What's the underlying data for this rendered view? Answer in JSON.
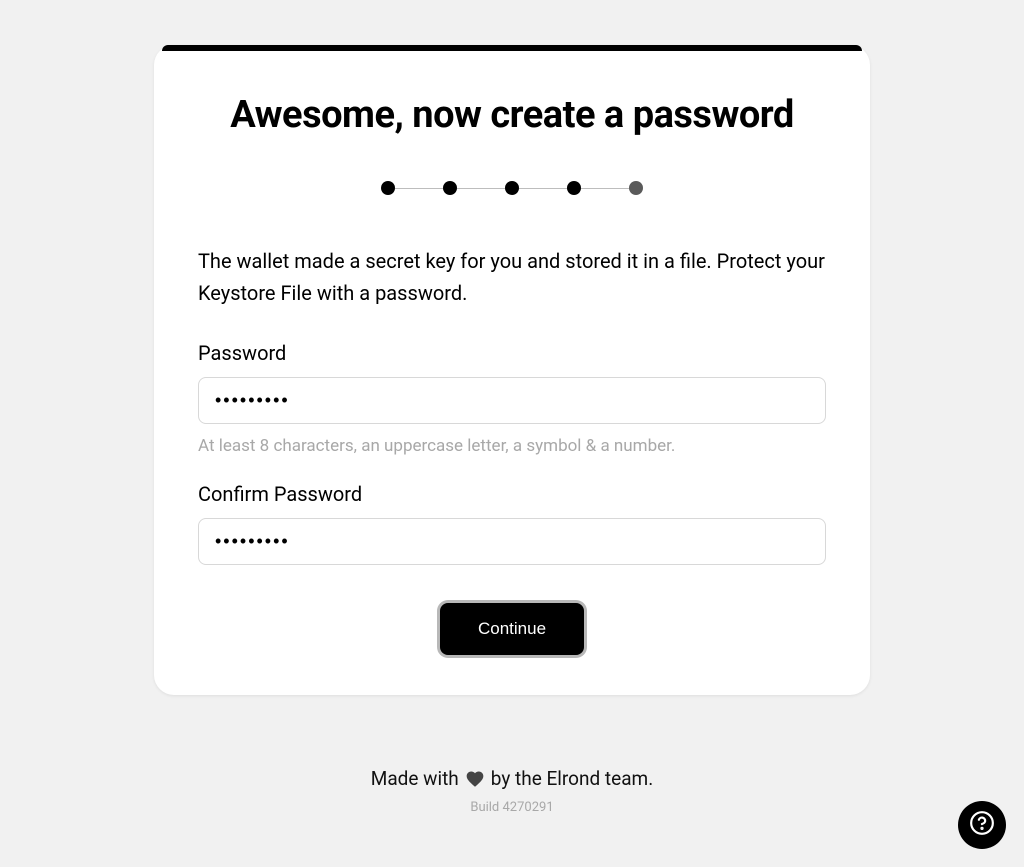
{
  "title": "Awesome, now create a password",
  "stepper": {
    "total": 5,
    "current": 4
  },
  "description": "The wallet made a secret key for you and stored it in a file. Protect your Keystore File with a password.",
  "password": {
    "label": "Password",
    "value": "•••••••••",
    "hint": "At least 8 characters, an uppercase letter, a symbol & a number."
  },
  "confirm_password": {
    "label": "Confirm Password",
    "value": "•••••••••"
  },
  "continue_label": "Continue",
  "footer": {
    "prefix": "Made with",
    "suffix": "by the Elrond team.",
    "build": "Build 4270291"
  }
}
